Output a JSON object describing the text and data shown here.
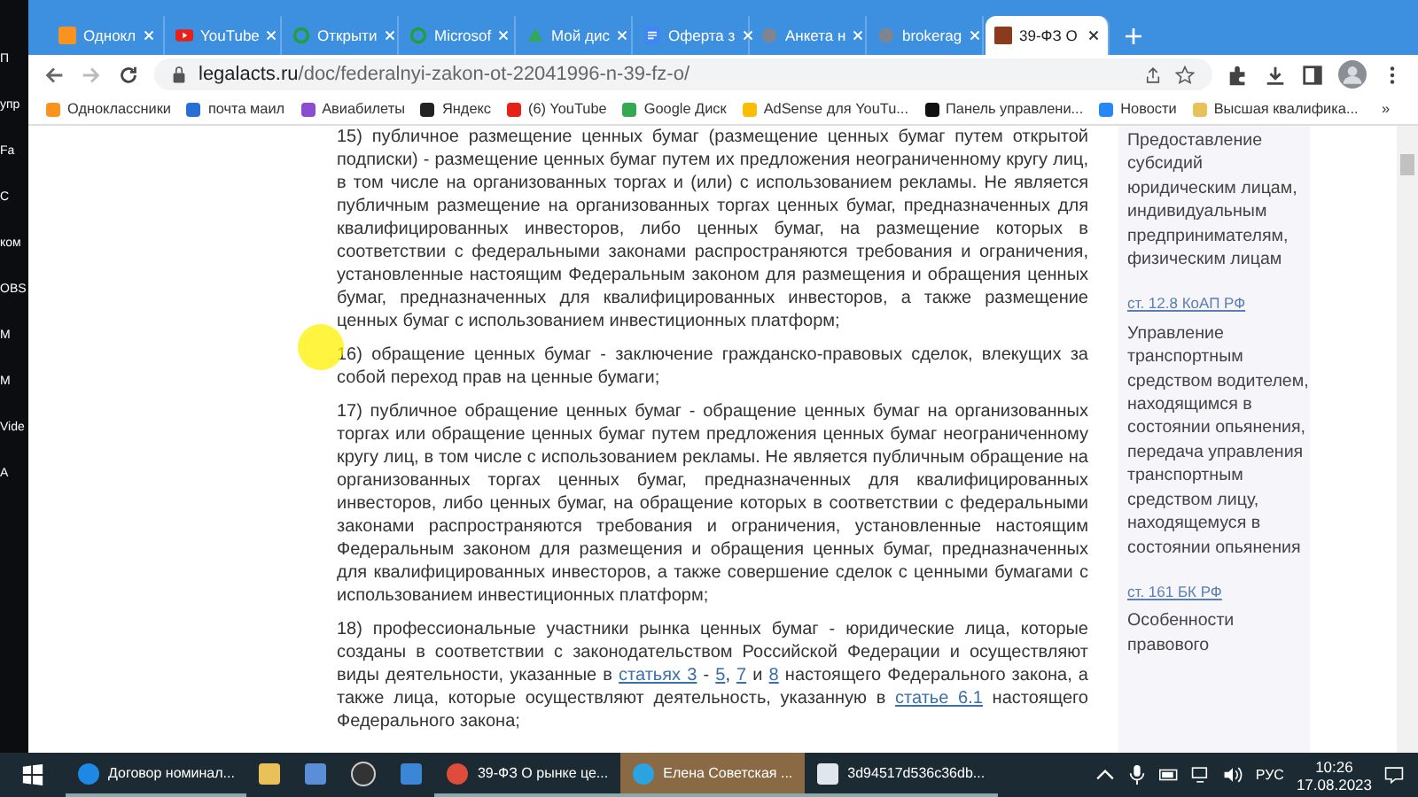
{
  "desktop": {
    "labels": [
      "П",
      "упр",
      "Fa",
      "C",
      "ком",
      "OBS",
      "M",
      "M",
      "Vide",
      "A"
    ]
  },
  "tabs": [
    {
      "label": "Однокл",
      "selected": false
    },
    {
      "label": "YouTube",
      "selected": false
    },
    {
      "label": "Открыти",
      "selected": false
    },
    {
      "label": "Microsof",
      "selected": false
    },
    {
      "label": "Мой дис",
      "selected": false
    },
    {
      "label": "Оферта з",
      "selected": false
    },
    {
      "label": "Анкета н",
      "selected": false
    },
    {
      "label": "brokerag",
      "selected": false
    },
    {
      "label": "39-ФЗ О",
      "selected": true
    }
  ],
  "address": {
    "host": "legalacts.ru",
    "path": "/doc/federalnyi-zakon-ot-22041996-n-39-fz-o/"
  },
  "bookmarks": [
    "Одноклассники",
    "почта маил",
    "Авиабилеты",
    "Яндекс",
    "(6) YouTube",
    "Google Диск",
    "AdSense для YouTu...",
    "Панель управлени...",
    "Новости",
    "Высшая квалифика..."
  ],
  "bookmarks_more": "»",
  "article": [
    [
      {
        "text": "15) публичное размещение ценных бумаг (размещение ценных бумаг путем открытой подписки) - размещение ценных бумаг путем их предложения неограниченному кругу лиц, в том числе на организованных торгах и (или) с использованием рекламы. Не является публичным размещение на организованных торгах ценных бумаг, предназначенных для квалифицированных инвесторов, либо ценных бумаг, на размещение которых в соответствии с федеральными законами распространяются требования и ограничения, установленные настоящим Федеральным законом для размещения и обращения ценных бумаг, предназначенных для квалифицированных инвесторов, а также размещение ценных бумаг с использованием инвестиционных платформ;",
        "link": false
      }
    ],
    [
      {
        "text": "16) обращение ценных бумаг - заключение гражданско-правовых сделок, влекущих за собой переход прав на ценные бумаги;",
        "link": false
      }
    ],
    [
      {
        "text": "17) публичное обращение ценных бумаг - обращение ценных бумаг на организованных торгах или обращение ценных бумаг путем предложения ценных бумаг неограниченному кругу лиц, в том числе с использованием рекламы. Не является публичным обращение на организованных торгах ценных бумаг, предназначенных для квалифицированных инвесторов, либо ценных бумаг, на обращение которых в соответствии с федеральными законами распространяются требования и ограничения, установленные настоящим Федеральным законом для размещения и обращения ценных бумаг, предназначенных для квалифицированных инвесторов, а также совершение сделок с ценными бумагами с использованием инвестиционных платформ;",
        "link": false
      }
    ],
    [
      {
        "text": "18) профессиональные участники рынка ценных бумаг - юридические лица, которые созданы в соответствии с законодательством Российской Федерации и осуществляют виды деятельности, указанные в ",
        "link": false
      },
      {
        "text": "статьях 3",
        "link": true
      },
      {
        "text": " - ",
        "link": false
      },
      {
        "text": "5",
        "link": true
      },
      {
        "text": ", ",
        "link": false
      },
      {
        "text": "7",
        "link": true
      },
      {
        "text": " и ",
        "link": false
      },
      {
        "text": "8",
        "link": true
      },
      {
        "text": " настоящего Федерального закона, а также лица, которые осуществляют деятельность, указанную в ",
        "link": false
      },
      {
        "text": "статье 6.1",
        "link": true
      },
      {
        "text": " настоящего Федерального закона;",
        "link": false
      }
    ]
  ],
  "sidebar": [
    {
      "text": "Предоставление субсидий юридическим лицам, индивидуальным предпринимателям, физическим лицам"
    },
    {
      "link": "ст. 12.8 КоАП РФ",
      "text": "Управление транспортным средством водителем, находящимся в состоянии опьянения, передача управления транспортным средством лицу, находящемуся в состоянии опьянения"
    },
    {
      "link": "ст. 161 БК РФ",
      "text": "Особенности правового"
    }
  ],
  "taskbar": [
    {
      "label": "Договор номинал...",
      "selected": false
    },
    {
      "selected": false
    },
    {
      "selected": false
    },
    {
      "selected": false
    },
    {
      "selected": false
    },
    {
      "label": "39-ФЗ О рынке це...",
      "selected": false
    },
    {
      "label": "Елена Советская ...",
      "selected": true
    },
    {
      "label": "3d94517d536c36db...",
      "selected": false
    }
  ],
  "tray": {
    "language": "РУС",
    "time": "10:26",
    "date": "17.08.2023"
  }
}
